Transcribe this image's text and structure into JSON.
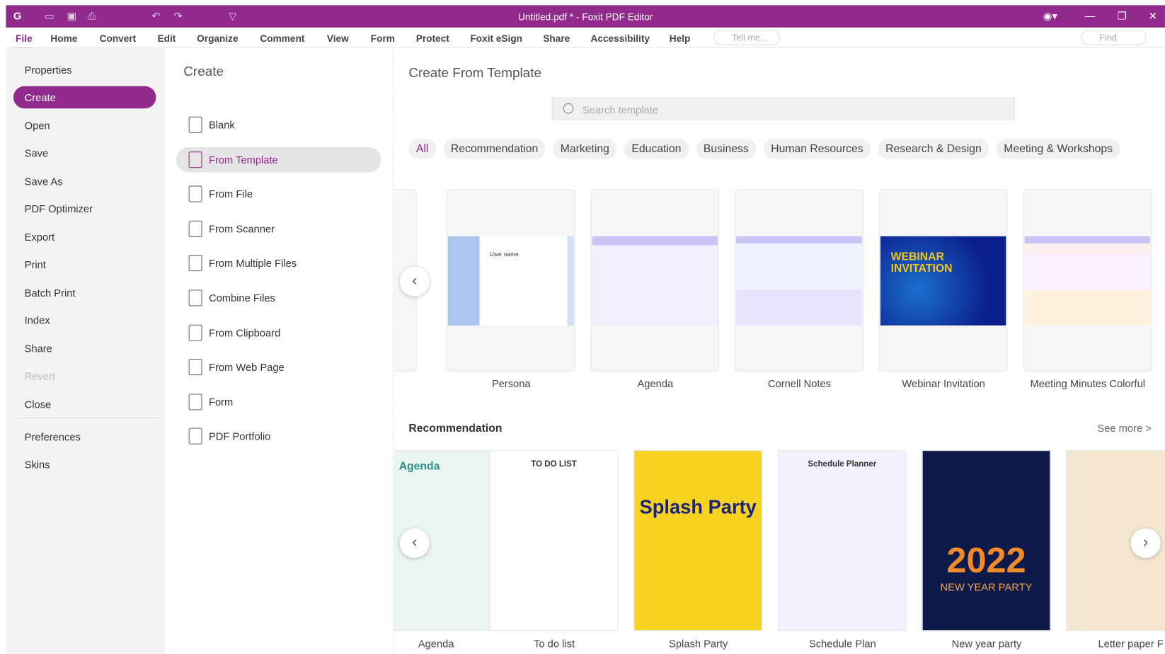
{
  "window": {
    "title": "Untitled.pdf * - Foxit PDF Editor"
  },
  "menu": [
    "File",
    "Home",
    "Convert",
    "Edit",
    "Organize",
    "Comment",
    "View",
    "Form",
    "Protect",
    "Foxit eSign",
    "Share",
    "Accessibility",
    "Help"
  ],
  "tell_me": "Tell me...",
  "find": "Find",
  "file_menu": [
    "Properties",
    "Create",
    "Open",
    "Save",
    "Save As",
    "PDF Optimizer",
    "Export",
    "Print",
    "Batch Print",
    "Index",
    "Share",
    "Revert",
    "Close",
    "Preferences",
    "Skins"
  ],
  "create": {
    "title": "Create",
    "items": [
      "Blank",
      "From Template",
      "From File",
      "From Scanner",
      "From Multiple Files",
      "Combine Files",
      "From Clipboard",
      "From Web Page",
      "Form",
      "PDF Portfolio"
    ]
  },
  "templates": {
    "title": "Create From Template",
    "search_placeholder": "Search template",
    "categories": [
      "All",
      "Recommendation",
      "Marketing",
      "Education",
      "Business",
      "Human Resources",
      "Research & Design",
      "Meeting & Workshops"
    ],
    "items": [
      "Persona",
      "Agenda",
      "Cornell Notes",
      "Webinar Invitation",
      "Meeting Minutes Colorful"
    ],
    "thumb_text": {
      "persona": "User name",
      "webinar": "WEBINAR INVITATION"
    }
  },
  "recommendation": {
    "title": "Recommendation",
    "see_more": "See more  >",
    "items": [
      "Agenda",
      "To do list",
      "Splash Party",
      "Schedule Plan",
      "New year party",
      "Letter paper F"
    ],
    "thumb_text": {
      "agenda": "Agenda",
      "todo": "TO DO LIST",
      "splash": "Splash Party",
      "schedule": "Schedule Planner",
      "newyear": "2022",
      "newyear_sub": "NEW YEAR PARTY"
    }
  },
  "colors": {
    "accent": "#922a8e"
  }
}
